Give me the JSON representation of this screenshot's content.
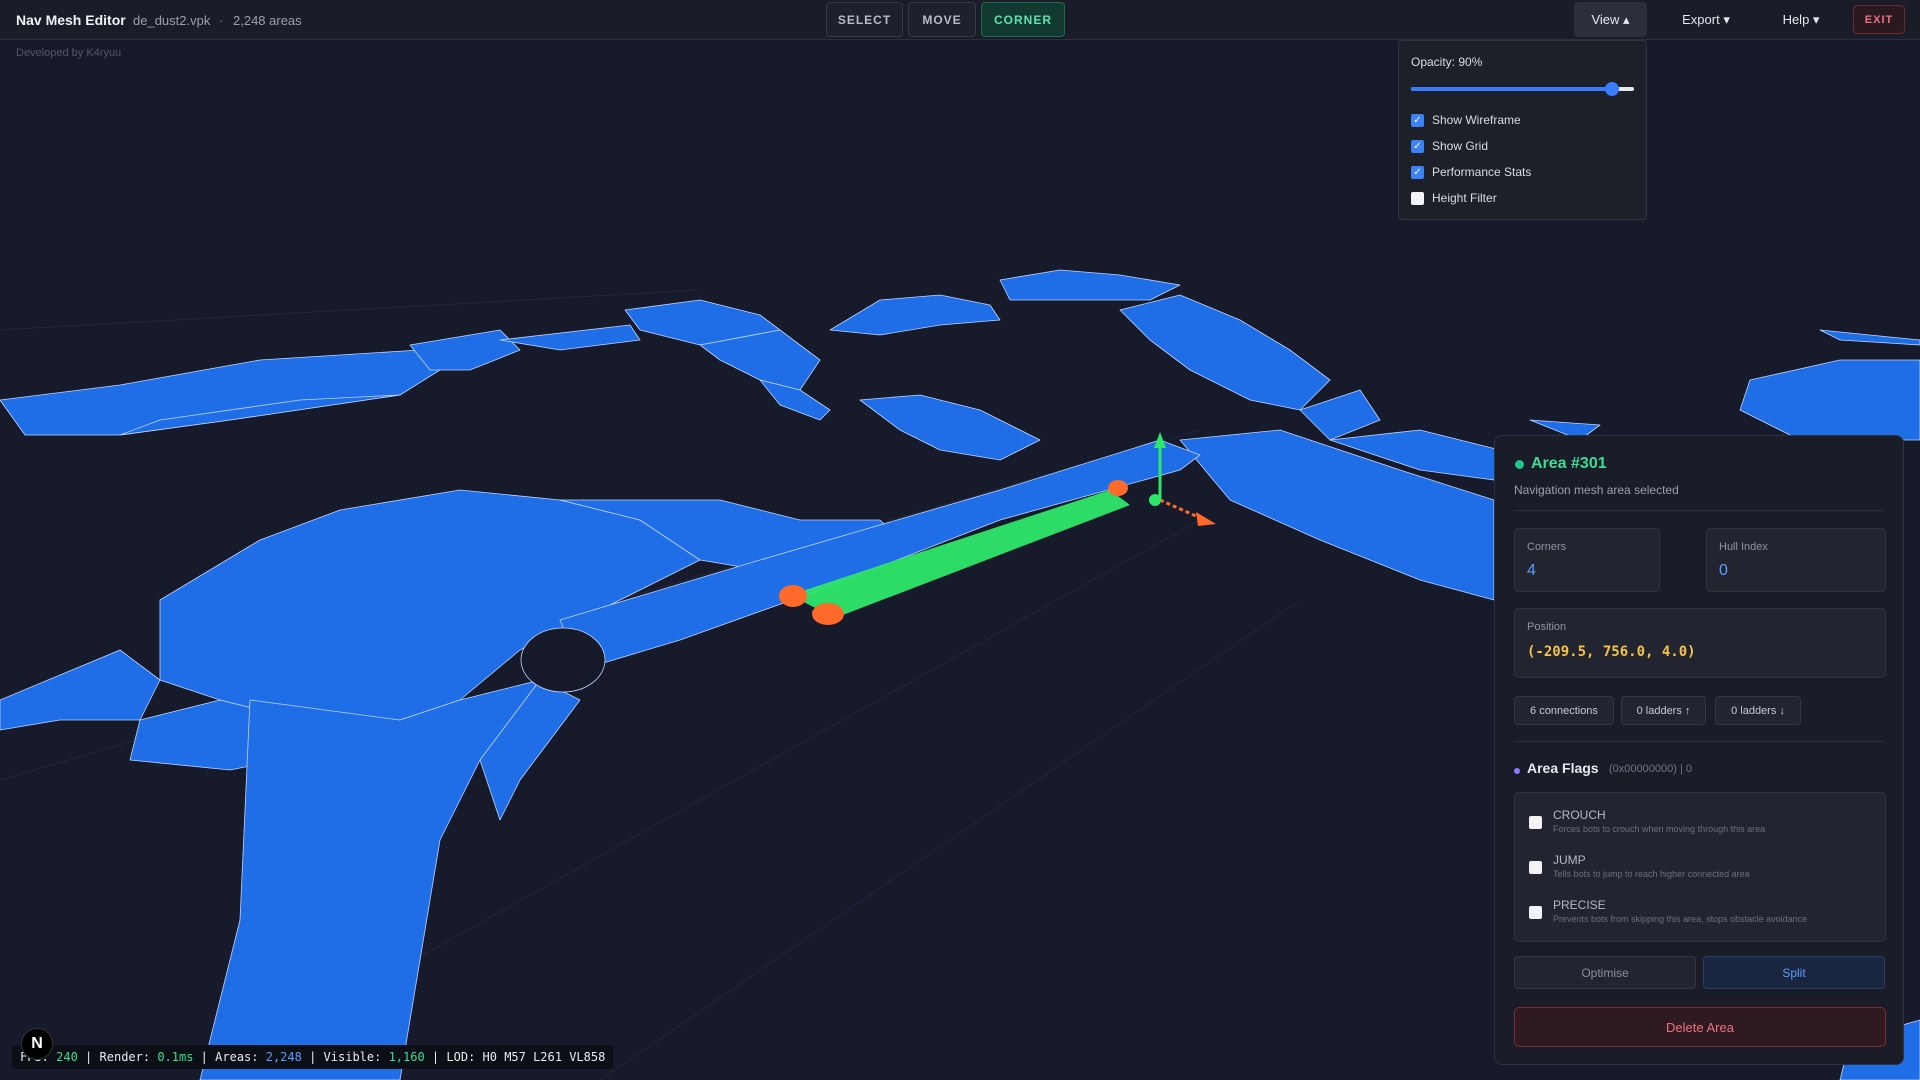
{
  "header": {
    "app_title": "Nav Mesh Editor",
    "file_name": "de_dust2.vpk",
    "separator": "·",
    "area_count": "2,248 areas",
    "modes": [
      {
        "label": "SELECT",
        "active": false
      },
      {
        "label": "MOVE",
        "active": false
      },
      {
        "label": "CORNER",
        "active": true
      }
    ],
    "menus": {
      "view": "View ▴",
      "export": "Export ▾",
      "help": "Help ▾"
    },
    "exit_label": "EXIT"
  },
  "credit": "Developed by K4ryuu",
  "view_menu": {
    "opacity_label": "Opacity: 90%",
    "opacity": 0.9,
    "options": [
      {
        "label": "Show Wireframe",
        "checked": true
      },
      {
        "label": "Show Grid",
        "checked": true
      },
      {
        "label": "Performance Stats",
        "checked": true
      },
      {
        "label": "Height Filter",
        "checked": false
      }
    ]
  },
  "inspector": {
    "title": "Area #301",
    "subtitle": "Navigation mesh area selected",
    "corners_label": "Corners",
    "corners_value": "4",
    "hull_label": "Hull Index",
    "hull_value": "0",
    "position_label": "Position",
    "position_value": "(-209.5, 756.0, 4.0)",
    "connections": "6 connections",
    "ladders_up": "0 ladders ↑",
    "ladders_down": "0 ladders ↓",
    "flags_title": "Area Flags",
    "flags_hex": "(0x00000000) | 0",
    "flags": [
      {
        "name": "CROUCH",
        "desc": "Forces bots to crouch when moving through this area",
        "checked": false
      },
      {
        "name": "JUMP",
        "desc": "Tells bots to jump to reach higher connected area",
        "checked": false
      },
      {
        "name": "PRECISE",
        "desc": "Prevents bots from skipping this area, stops obstacle avoidance",
        "checked": false
      }
    ],
    "optimise_label": "Optimise",
    "split_label": "Split",
    "delete_label": "Delete Area"
  },
  "perf": {
    "fps_label": "FPS:",
    "fps": "240",
    "render_label": "Render:",
    "render": "0.1ms",
    "areas_label": "Areas:",
    "areas": "2,248",
    "visible_label": "Visible:",
    "visible": "1,160",
    "lod": "LOD: H0 M57 L261 VL858"
  },
  "colors": {
    "mesh": "#1f6ee8",
    "mesh_edge": "#bcd4ff",
    "selected": "#2ee66a",
    "handle": "#ff6a2a",
    "accent": "#3ddc97"
  }
}
